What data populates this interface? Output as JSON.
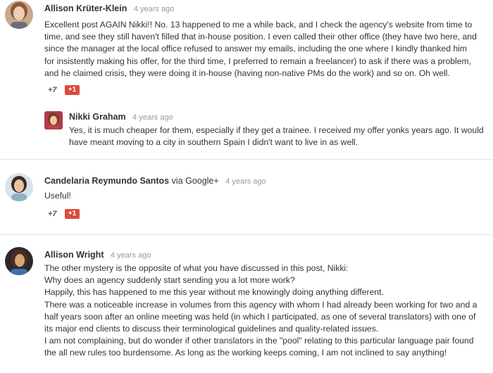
{
  "comments": [
    {
      "author": "Allison Krüter-Klein",
      "time": "4 years ago",
      "lines": [
        "Excellent post AGAIN Nikki!! No. 13 happened to me a while back, and I check the agency's website from time to",
        "time, and see they still haven't filled that in-house position. I even called their other office (they have two here, and",
        "since the manager at the local office refused to answer my emails, including the one where I kindly thanked him",
        "for insistently making his offer, for the third time, I preferred to remain a freelancer) to ask if there was a problem,",
        "and he claimed crisis, they were doing it in-house (having non-native PMs do the work) and so on. Oh well."
      ],
      "plus_count": "+7",
      "plus_button": "+1",
      "avatar_icon": "avatar-photo"
    },
    {
      "author": "Nikki Graham",
      "time": "4 years ago",
      "lines": [
        "Yes, it is much cheaper for them, especially if they get a trainee. I received my offer yonks years ago. It would",
        "have meant moving to a city in southern Spain I didn't want to live in as well."
      ],
      "avatar_icon": "avatar-photo"
    },
    {
      "author": "Candelaria Reymundo Santos",
      "via_text": "via",
      "via_source": "Google+",
      "time": "4 years ago",
      "lines": [
        "Useful!"
      ],
      "plus_count": "+7",
      "plus_button": "+1",
      "avatar_icon": "avatar-photo"
    },
    {
      "author": "Allison Wright",
      "time": "4 years ago",
      "lines": [
        "The other mystery is the opposite of what you have discussed in this post, Nikki:",
        "Why does an agency suddenly start sending you a lot more work?",
        "Happily, this has happened to me this year without me knowingly doing anything different.",
        "There was a noticeable increase in volumes from this agency with whom I had already been working for two and a",
        "half years soon after an online meeting was held (in which I participated, as one of several translators) with one of",
        "its major end clients to discuss their terminological guidelines and quality-related issues.",
        "I am not complaining, but do wonder if other translators in the \"pool\" relating to this particular language pair found",
        "the all new rules too burdensome. As long as the working keeps coming, I am not inclined to say anything!"
      ],
      "avatar_icon": "avatar-photo"
    }
  ],
  "colors": {
    "plus_button_bg": "#dd4b39",
    "timestamp": "#999999",
    "divider": "#e5e5e5"
  }
}
